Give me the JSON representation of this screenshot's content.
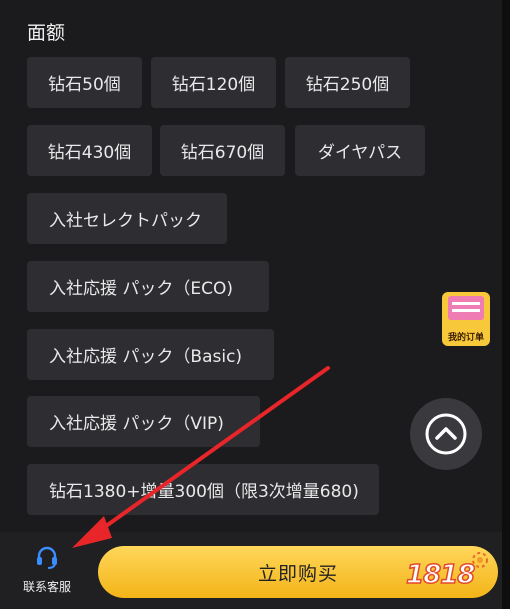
{
  "section_title": "面额",
  "options": [
    {
      "label": "钻石50個"
    },
    {
      "label": "钻石120個"
    },
    {
      "label": "钻石250個"
    },
    {
      "label": "钻石430個"
    },
    {
      "label": "钻石670個"
    },
    {
      "label": "ダイヤパス"
    },
    {
      "label": "入社セレクトパック"
    },
    {
      "label": "入社応援 パック（ECO)"
    },
    {
      "label": "入社応援 パック（Basic)"
    },
    {
      "label": "入社応援 パック（VIP)"
    },
    {
      "label": "钻石1380+增量300個（限3次增量680)"
    }
  ],
  "float_badge": {
    "label": "我的订单"
  },
  "bottom": {
    "service_label": "联系客服",
    "buy_label": "立即购买"
  },
  "watermark": {
    "text": "1818"
  },
  "colors": {
    "background": "#1b1b1d",
    "option_bg": "#2e2e32",
    "buy_button": "#f6c02a",
    "arrow": "#e8262a"
  },
  "icons": [
    "headset-icon",
    "chevron-up-icon",
    "order-icon",
    "arrow-annotation"
  ]
}
